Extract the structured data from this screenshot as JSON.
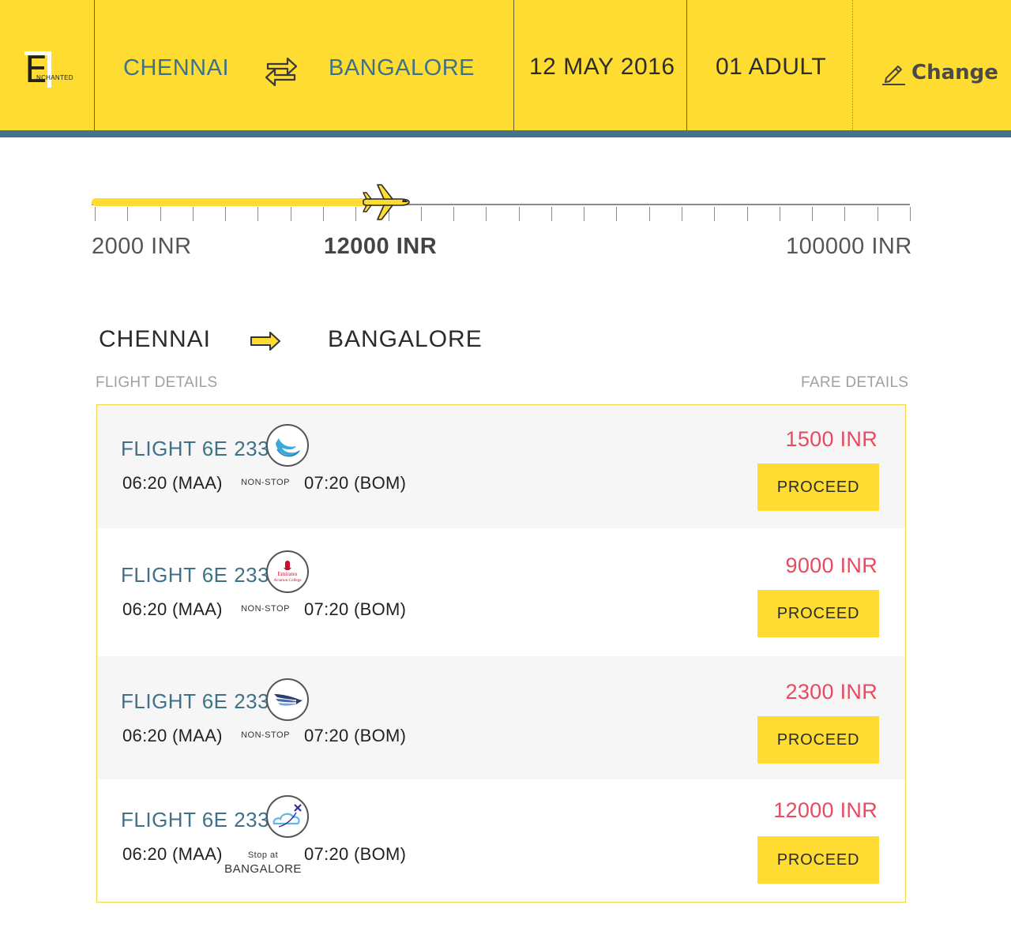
{
  "header": {
    "logo_letter": "E",
    "logo_text": "NCHANTED",
    "from": "CHENNAI",
    "to": "BANGALORE",
    "date": "12 MAY 2016",
    "passengers": "01 ADULT",
    "change_label": "Change",
    "accent_color": "#fedc32",
    "bar_color": "#43738a"
  },
  "price_slider": {
    "min_label": "2000 INR",
    "current_label": "12000 INR",
    "max_label": "100000 INR",
    "min": 2000,
    "max": 100000,
    "value": 12000,
    "handle_icon": "airplane-icon"
  },
  "route": {
    "from": "CHENNAI",
    "to": "BANGALORE",
    "flight_details_label": "FLIGHT DETAILS",
    "fare_details_label": "FARE DETAILS"
  },
  "flights": [
    {
      "name": "FLIGHT 6E 233",
      "airline_icon": "swirl-logo-icon",
      "depart": "06:20 (MAA)",
      "stop_label": "NON-STOP",
      "stop_city": "",
      "arrive": "07:20 (BOM)",
      "fare": "1500 INR",
      "proceed_label": "PROCEED"
    },
    {
      "name": "FLIGHT 6E 233",
      "airline_icon": "emirates-aviation-college-logo-icon",
      "logo_text_1": "Emirates",
      "logo_text_2": "Aviation College",
      "depart": "06:20 (MAA)",
      "stop_label": "NON-STOP",
      "stop_city": "",
      "arrive": "07:20 (BOM)",
      "fare": "9000 INR",
      "proceed_label": "PROCEED"
    },
    {
      "name": "FLIGHT 6E 233",
      "airline_icon": "bird-wing-logo-icon",
      "depart": "06:20 (MAA)",
      "stop_label": "NON-STOP",
      "stop_city": "",
      "arrive": "07:20 (BOM)",
      "fare": "2300 INR",
      "proceed_label": "PROCEED"
    },
    {
      "name": "FLIGHT 6E 233",
      "airline_icon": "cloud-plane-logo-icon",
      "depart": "06:20 (MAA)",
      "stop_label": "Stop at",
      "stop_city": "BANGALORE",
      "arrive": "07:20 (BOM)",
      "fare": "12000 INR",
      "proceed_label": "PROCEED"
    }
  ]
}
